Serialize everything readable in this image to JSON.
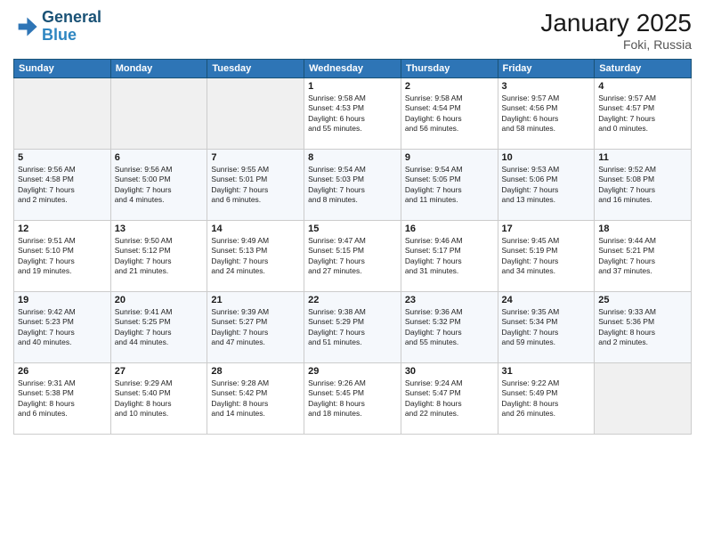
{
  "header": {
    "logo_line1": "General",
    "logo_line2": "Blue",
    "month": "January 2025",
    "location": "Foki, Russia"
  },
  "days_of_week": [
    "Sunday",
    "Monday",
    "Tuesday",
    "Wednesday",
    "Thursday",
    "Friday",
    "Saturday"
  ],
  "weeks": [
    [
      {
        "day": "",
        "content": ""
      },
      {
        "day": "",
        "content": ""
      },
      {
        "day": "",
        "content": ""
      },
      {
        "day": "1",
        "content": "Sunrise: 9:58 AM\nSunset: 4:53 PM\nDaylight: 6 hours\nand 55 minutes."
      },
      {
        "day": "2",
        "content": "Sunrise: 9:58 AM\nSunset: 4:54 PM\nDaylight: 6 hours\nand 56 minutes."
      },
      {
        "day": "3",
        "content": "Sunrise: 9:57 AM\nSunset: 4:56 PM\nDaylight: 6 hours\nand 58 minutes."
      },
      {
        "day": "4",
        "content": "Sunrise: 9:57 AM\nSunset: 4:57 PM\nDaylight: 7 hours\nand 0 minutes."
      }
    ],
    [
      {
        "day": "5",
        "content": "Sunrise: 9:56 AM\nSunset: 4:58 PM\nDaylight: 7 hours\nand 2 minutes."
      },
      {
        "day": "6",
        "content": "Sunrise: 9:56 AM\nSunset: 5:00 PM\nDaylight: 7 hours\nand 4 minutes."
      },
      {
        "day": "7",
        "content": "Sunrise: 9:55 AM\nSunset: 5:01 PM\nDaylight: 7 hours\nand 6 minutes."
      },
      {
        "day": "8",
        "content": "Sunrise: 9:54 AM\nSunset: 5:03 PM\nDaylight: 7 hours\nand 8 minutes."
      },
      {
        "day": "9",
        "content": "Sunrise: 9:54 AM\nSunset: 5:05 PM\nDaylight: 7 hours\nand 11 minutes."
      },
      {
        "day": "10",
        "content": "Sunrise: 9:53 AM\nSunset: 5:06 PM\nDaylight: 7 hours\nand 13 minutes."
      },
      {
        "day": "11",
        "content": "Sunrise: 9:52 AM\nSunset: 5:08 PM\nDaylight: 7 hours\nand 16 minutes."
      }
    ],
    [
      {
        "day": "12",
        "content": "Sunrise: 9:51 AM\nSunset: 5:10 PM\nDaylight: 7 hours\nand 19 minutes."
      },
      {
        "day": "13",
        "content": "Sunrise: 9:50 AM\nSunset: 5:12 PM\nDaylight: 7 hours\nand 21 minutes."
      },
      {
        "day": "14",
        "content": "Sunrise: 9:49 AM\nSunset: 5:13 PM\nDaylight: 7 hours\nand 24 minutes."
      },
      {
        "day": "15",
        "content": "Sunrise: 9:47 AM\nSunset: 5:15 PM\nDaylight: 7 hours\nand 27 minutes."
      },
      {
        "day": "16",
        "content": "Sunrise: 9:46 AM\nSunset: 5:17 PM\nDaylight: 7 hours\nand 31 minutes."
      },
      {
        "day": "17",
        "content": "Sunrise: 9:45 AM\nSunset: 5:19 PM\nDaylight: 7 hours\nand 34 minutes."
      },
      {
        "day": "18",
        "content": "Sunrise: 9:44 AM\nSunset: 5:21 PM\nDaylight: 7 hours\nand 37 minutes."
      }
    ],
    [
      {
        "day": "19",
        "content": "Sunrise: 9:42 AM\nSunset: 5:23 PM\nDaylight: 7 hours\nand 40 minutes."
      },
      {
        "day": "20",
        "content": "Sunrise: 9:41 AM\nSunset: 5:25 PM\nDaylight: 7 hours\nand 44 minutes."
      },
      {
        "day": "21",
        "content": "Sunrise: 9:39 AM\nSunset: 5:27 PM\nDaylight: 7 hours\nand 47 minutes."
      },
      {
        "day": "22",
        "content": "Sunrise: 9:38 AM\nSunset: 5:29 PM\nDaylight: 7 hours\nand 51 minutes."
      },
      {
        "day": "23",
        "content": "Sunrise: 9:36 AM\nSunset: 5:32 PM\nDaylight: 7 hours\nand 55 minutes."
      },
      {
        "day": "24",
        "content": "Sunrise: 9:35 AM\nSunset: 5:34 PM\nDaylight: 7 hours\nand 59 minutes."
      },
      {
        "day": "25",
        "content": "Sunrise: 9:33 AM\nSunset: 5:36 PM\nDaylight: 8 hours\nand 2 minutes."
      }
    ],
    [
      {
        "day": "26",
        "content": "Sunrise: 9:31 AM\nSunset: 5:38 PM\nDaylight: 8 hours\nand 6 minutes."
      },
      {
        "day": "27",
        "content": "Sunrise: 9:29 AM\nSunset: 5:40 PM\nDaylight: 8 hours\nand 10 minutes."
      },
      {
        "day": "28",
        "content": "Sunrise: 9:28 AM\nSunset: 5:42 PM\nDaylight: 8 hours\nand 14 minutes."
      },
      {
        "day": "29",
        "content": "Sunrise: 9:26 AM\nSunset: 5:45 PM\nDaylight: 8 hours\nand 18 minutes."
      },
      {
        "day": "30",
        "content": "Sunrise: 9:24 AM\nSunset: 5:47 PM\nDaylight: 8 hours\nand 22 minutes."
      },
      {
        "day": "31",
        "content": "Sunrise: 9:22 AM\nSunset: 5:49 PM\nDaylight: 8 hours\nand 26 minutes."
      },
      {
        "day": "",
        "content": ""
      }
    ]
  ]
}
